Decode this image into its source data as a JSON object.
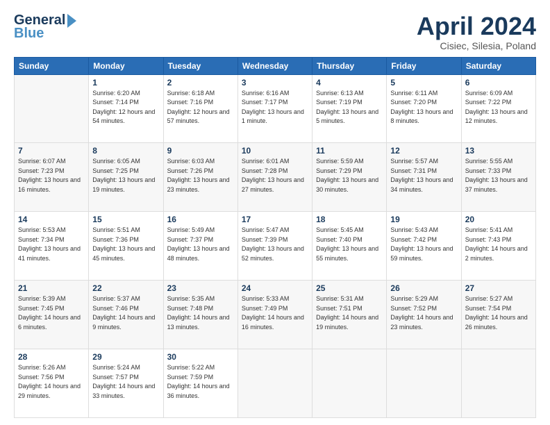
{
  "header": {
    "logo_line1": "General",
    "logo_line2": "Blue",
    "month_title": "April 2024",
    "subtitle": "Cisiec, Silesia, Poland"
  },
  "weekdays": [
    "Sunday",
    "Monday",
    "Tuesday",
    "Wednesday",
    "Thursday",
    "Friday",
    "Saturday"
  ],
  "weeks": [
    [
      {
        "day": "",
        "sunrise": "",
        "sunset": "",
        "daylight": ""
      },
      {
        "day": "1",
        "sunrise": "Sunrise: 6:20 AM",
        "sunset": "Sunset: 7:14 PM",
        "daylight": "Daylight: 12 hours and 54 minutes."
      },
      {
        "day": "2",
        "sunrise": "Sunrise: 6:18 AM",
        "sunset": "Sunset: 7:16 PM",
        "daylight": "Daylight: 12 hours and 57 minutes."
      },
      {
        "day": "3",
        "sunrise": "Sunrise: 6:16 AM",
        "sunset": "Sunset: 7:17 PM",
        "daylight": "Daylight: 13 hours and 1 minute."
      },
      {
        "day": "4",
        "sunrise": "Sunrise: 6:13 AM",
        "sunset": "Sunset: 7:19 PM",
        "daylight": "Daylight: 13 hours and 5 minutes."
      },
      {
        "day": "5",
        "sunrise": "Sunrise: 6:11 AM",
        "sunset": "Sunset: 7:20 PM",
        "daylight": "Daylight: 13 hours and 8 minutes."
      },
      {
        "day": "6",
        "sunrise": "Sunrise: 6:09 AM",
        "sunset": "Sunset: 7:22 PM",
        "daylight": "Daylight: 13 hours and 12 minutes."
      }
    ],
    [
      {
        "day": "7",
        "sunrise": "Sunrise: 6:07 AM",
        "sunset": "Sunset: 7:23 PM",
        "daylight": "Daylight: 13 hours and 16 minutes."
      },
      {
        "day": "8",
        "sunrise": "Sunrise: 6:05 AM",
        "sunset": "Sunset: 7:25 PM",
        "daylight": "Daylight: 13 hours and 19 minutes."
      },
      {
        "day": "9",
        "sunrise": "Sunrise: 6:03 AM",
        "sunset": "Sunset: 7:26 PM",
        "daylight": "Daylight: 13 hours and 23 minutes."
      },
      {
        "day": "10",
        "sunrise": "Sunrise: 6:01 AM",
        "sunset": "Sunset: 7:28 PM",
        "daylight": "Daylight: 13 hours and 27 minutes."
      },
      {
        "day": "11",
        "sunrise": "Sunrise: 5:59 AM",
        "sunset": "Sunset: 7:29 PM",
        "daylight": "Daylight: 13 hours and 30 minutes."
      },
      {
        "day": "12",
        "sunrise": "Sunrise: 5:57 AM",
        "sunset": "Sunset: 7:31 PM",
        "daylight": "Daylight: 13 hours and 34 minutes."
      },
      {
        "day": "13",
        "sunrise": "Sunrise: 5:55 AM",
        "sunset": "Sunset: 7:33 PM",
        "daylight": "Daylight: 13 hours and 37 minutes."
      }
    ],
    [
      {
        "day": "14",
        "sunrise": "Sunrise: 5:53 AM",
        "sunset": "Sunset: 7:34 PM",
        "daylight": "Daylight: 13 hours and 41 minutes."
      },
      {
        "day": "15",
        "sunrise": "Sunrise: 5:51 AM",
        "sunset": "Sunset: 7:36 PM",
        "daylight": "Daylight: 13 hours and 45 minutes."
      },
      {
        "day": "16",
        "sunrise": "Sunrise: 5:49 AM",
        "sunset": "Sunset: 7:37 PM",
        "daylight": "Daylight: 13 hours and 48 minutes."
      },
      {
        "day": "17",
        "sunrise": "Sunrise: 5:47 AM",
        "sunset": "Sunset: 7:39 PM",
        "daylight": "Daylight: 13 hours and 52 minutes."
      },
      {
        "day": "18",
        "sunrise": "Sunrise: 5:45 AM",
        "sunset": "Sunset: 7:40 PM",
        "daylight": "Daylight: 13 hours and 55 minutes."
      },
      {
        "day": "19",
        "sunrise": "Sunrise: 5:43 AM",
        "sunset": "Sunset: 7:42 PM",
        "daylight": "Daylight: 13 hours and 59 minutes."
      },
      {
        "day": "20",
        "sunrise": "Sunrise: 5:41 AM",
        "sunset": "Sunset: 7:43 PM",
        "daylight": "Daylight: 14 hours and 2 minutes."
      }
    ],
    [
      {
        "day": "21",
        "sunrise": "Sunrise: 5:39 AM",
        "sunset": "Sunset: 7:45 PM",
        "daylight": "Daylight: 14 hours and 6 minutes."
      },
      {
        "day": "22",
        "sunrise": "Sunrise: 5:37 AM",
        "sunset": "Sunset: 7:46 PM",
        "daylight": "Daylight: 14 hours and 9 minutes."
      },
      {
        "day": "23",
        "sunrise": "Sunrise: 5:35 AM",
        "sunset": "Sunset: 7:48 PM",
        "daylight": "Daylight: 14 hours and 13 minutes."
      },
      {
        "day": "24",
        "sunrise": "Sunrise: 5:33 AM",
        "sunset": "Sunset: 7:49 PM",
        "daylight": "Daylight: 14 hours and 16 minutes."
      },
      {
        "day": "25",
        "sunrise": "Sunrise: 5:31 AM",
        "sunset": "Sunset: 7:51 PM",
        "daylight": "Daylight: 14 hours and 19 minutes."
      },
      {
        "day": "26",
        "sunrise": "Sunrise: 5:29 AM",
        "sunset": "Sunset: 7:52 PM",
        "daylight": "Daylight: 14 hours and 23 minutes."
      },
      {
        "day": "27",
        "sunrise": "Sunrise: 5:27 AM",
        "sunset": "Sunset: 7:54 PM",
        "daylight": "Daylight: 14 hours and 26 minutes."
      }
    ],
    [
      {
        "day": "28",
        "sunrise": "Sunrise: 5:26 AM",
        "sunset": "Sunset: 7:56 PM",
        "daylight": "Daylight: 14 hours and 29 minutes."
      },
      {
        "day": "29",
        "sunrise": "Sunrise: 5:24 AM",
        "sunset": "Sunset: 7:57 PM",
        "daylight": "Daylight: 14 hours and 33 minutes."
      },
      {
        "day": "30",
        "sunrise": "Sunrise: 5:22 AM",
        "sunset": "Sunset: 7:59 PM",
        "daylight": "Daylight: 14 hours and 36 minutes."
      },
      {
        "day": "",
        "sunrise": "",
        "sunset": "",
        "daylight": ""
      },
      {
        "day": "",
        "sunrise": "",
        "sunset": "",
        "daylight": ""
      },
      {
        "day": "",
        "sunrise": "",
        "sunset": "",
        "daylight": ""
      },
      {
        "day": "",
        "sunrise": "",
        "sunset": "",
        "daylight": ""
      }
    ]
  ]
}
